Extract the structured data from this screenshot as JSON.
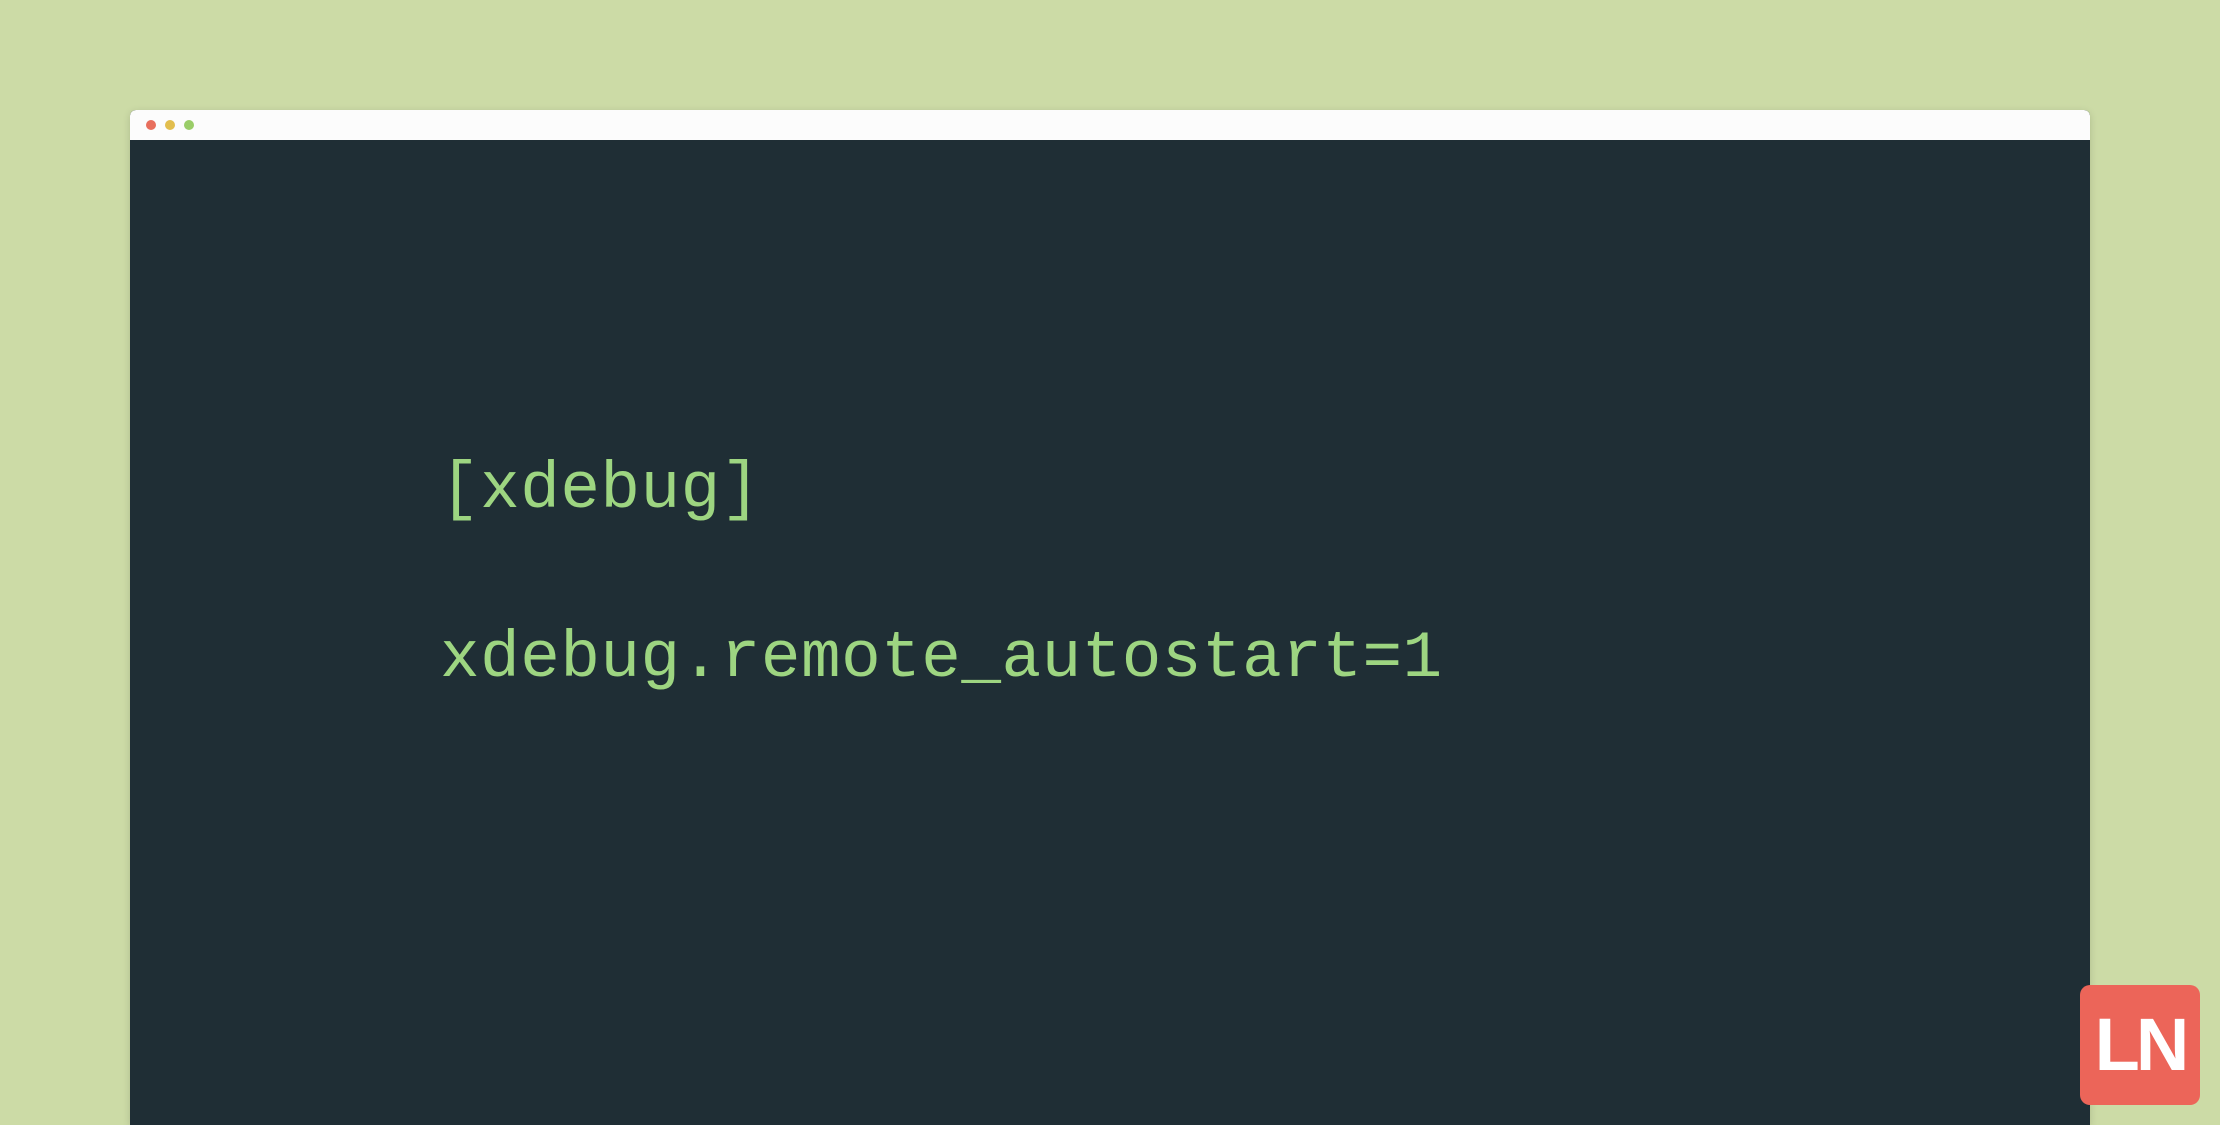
{
  "terminal": {
    "lines": [
      "[xdebug]",
      "",
      "xdebug.remote_autostart=1"
    ]
  },
  "badge": {
    "text": "LN"
  },
  "colors": {
    "background": "#ccdba6",
    "terminal_bg": "#1f2e35",
    "code_text": "#9dd581",
    "badge_bg": "#ec6559",
    "badge_text": "#ffffff"
  }
}
